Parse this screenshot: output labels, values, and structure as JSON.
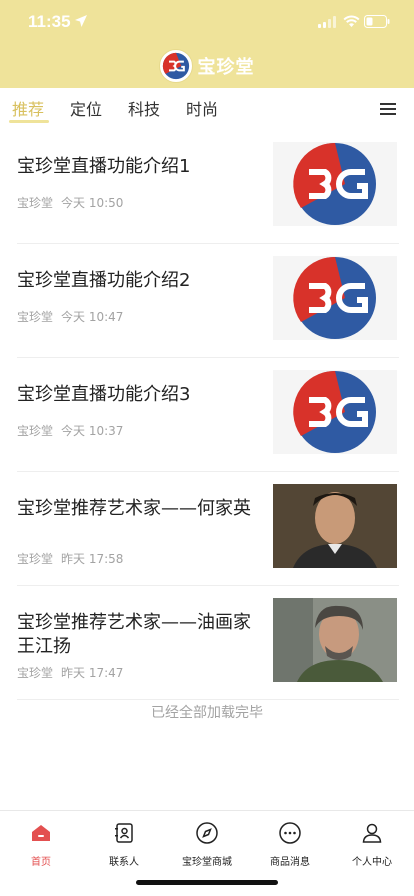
{
  "status_bar": {
    "time": "11:35"
  },
  "header": {
    "title": "宝珍堂"
  },
  "tabs": [
    {
      "label": "推荐",
      "active": true
    },
    {
      "label": "定位",
      "active": false
    },
    {
      "label": "科技",
      "active": false
    },
    {
      "label": "时尚",
      "active": false
    }
  ],
  "feed": [
    {
      "title": "宝珍堂直播功能介绍1",
      "source": "宝珍堂",
      "time": "今天 10:50",
      "thumb": "logo"
    },
    {
      "title": "宝珍堂直播功能介绍2",
      "source": "宝珍堂",
      "time": "今天 10:47",
      "thumb": "logo"
    },
    {
      "title": "宝珍堂直播功能介绍3",
      "source": "宝珍堂",
      "time": "今天 10:37",
      "thumb": "logo"
    },
    {
      "title": "宝珍堂推荐艺术家——何家英",
      "source": "宝珍堂",
      "time": "昨天 17:58",
      "thumb": "portrait-1"
    },
    {
      "title": "宝珍堂推荐艺术家——油画家王江扬",
      "source": "宝珍堂",
      "time": "昨天 17:47",
      "thumb": "portrait-2"
    }
  ],
  "footer_note": "已经全部加载完毕",
  "bottom_nav": [
    {
      "label": "首页",
      "icon": "home-icon",
      "active": true
    },
    {
      "label": "联系人",
      "icon": "contacts-icon",
      "active": false
    },
    {
      "label": "宝珍堂商城",
      "icon": "compass-icon",
      "active": false
    },
    {
      "label": "商品消息",
      "icon": "message-icon",
      "active": false
    },
    {
      "label": "个人中心",
      "icon": "person-icon",
      "active": false
    }
  ],
  "colors": {
    "header_bg": "#efe39a",
    "active_tab": "#d8c05e",
    "nav_active": "#e35050",
    "logo_red": "#d8322a",
    "logo_blue": "#2f5aa3"
  }
}
